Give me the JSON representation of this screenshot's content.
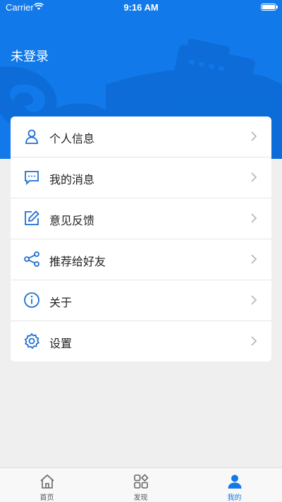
{
  "status_bar": {
    "carrier": "Carrier",
    "time": "9:16 AM"
  },
  "header": {
    "login_status": "未登录",
    "accent": "#1179ea"
  },
  "menu": {
    "items": [
      {
        "label": "个人信息",
        "icon": "person-icon"
      },
      {
        "label": "我的消息",
        "icon": "message-icon"
      },
      {
        "label": "意见反馈",
        "icon": "edit-icon"
      },
      {
        "label": "推荐给好友",
        "icon": "share-icon"
      },
      {
        "label": "关于",
        "icon": "info-icon"
      },
      {
        "label": "设置",
        "icon": "gear-icon"
      }
    ]
  },
  "tabbar": {
    "tabs": [
      {
        "label": "首页",
        "icon": "home-icon"
      },
      {
        "label": "发现",
        "icon": "discover-icon"
      },
      {
        "label": "我的",
        "icon": "profile-icon",
        "active": true
      }
    ]
  }
}
